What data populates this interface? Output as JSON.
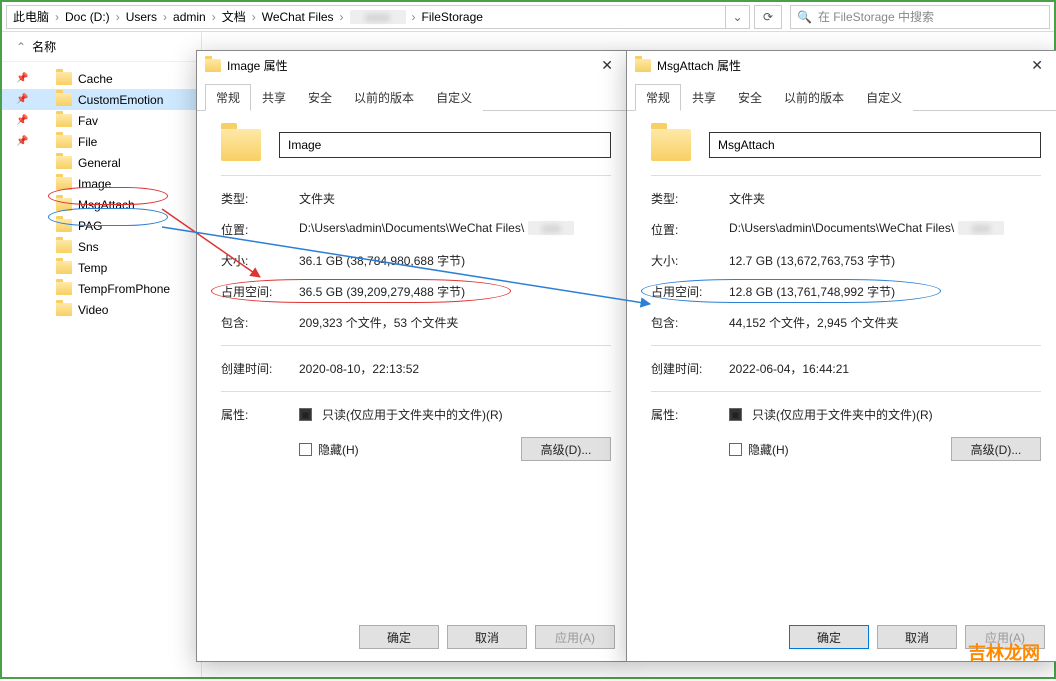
{
  "breadcrumb": {
    "root": "此电脑",
    "parts": [
      "Doc (D:)",
      "Users",
      "admin",
      "文档",
      "WeChat Files",
      "",
      "FileStorage"
    ],
    "blur_index": 5,
    "search_placeholder": "在 FileStorage 中搜索"
  },
  "tree": {
    "header": "名称",
    "items": [
      {
        "label": "Cache",
        "pinned": true
      },
      {
        "label": "CustomEmotion",
        "pinned": true,
        "selected": true
      },
      {
        "label": "Fav",
        "pinned": true
      },
      {
        "label": "File",
        "pinned": true
      },
      {
        "label": "General",
        "pinned": false
      },
      {
        "label": "Image",
        "pinned": false,
        "ring": "red"
      },
      {
        "label": "MsgAttach",
        "pinned": false,
        "ring": "blue"
      },
      {
        "label": "PAG",
        "pinned": false
      },
      {
        "label": "Sns",
        "pinned": false
      },
      {
        "label": "Temp",
        "pinned": false
      },
      {
        "label": "TempFromPhone",
        "pinned": false
      },
      {
        "label": "Video",
        "pinned": false
      }
    ]
  },
  "tabs": {
    "items": [
      "常规",
      "共享",
      "安全",
      "以前的版本",
      "自定义"
    ],
    "active": 0
  },
  "labels": {
    "type": "类型:",
    "location": "位置:",
    "size": "大小:",
    "disk": "占用空间:",
    "contains": "包含:",
    "created": "创建时间:",
    "attrs": "属性:",
    "readonly": "只读(仅应用于文件夹中的文件)(R)",
    "hidden": "隐藏(H)",
    "advanced": "高级(D)...",
    "ok": "确定",
    "cancel": "取消",
    "apply": "应用(A)",
    "folder_type": "文件夹"
  },
  "dialogs": [
    {
      "title_suffix": "属性",
      "name": "Image",
      "location_prefix": "D:\\Users\\admin\\Documents\\WeChat Files\\",
      "size": "36.1 GB (38,784,980,688 字节)",
      "disk": "36.5 GB (39,209,279,488 字节)",
      "contains": "209,323 个文件，53 个文件夹",
      "created": "2020-08-10，22:13:52",
      "disk_ring": "red",
      "primary_ok": false
    },
    {
      "title_suffix": "属性",
      "name": "MsgAttach",
      "location_prefix": "D:\\Users\\admin\\Documents\\WeChat Files\\",
      "size": "12.7 GB (13,672,763,753 字节)",
      "disk": "12.8 GB (13,761,748,992 字节)",
      "contains": "44,152 个文件，2,945 个文件夹",
      "created": "2022-06-04，16:44:21",
      "disk_ring": "blue",
      "primary_ok": true
    }
  ],
  "watermark": "吉林龙网"
}
